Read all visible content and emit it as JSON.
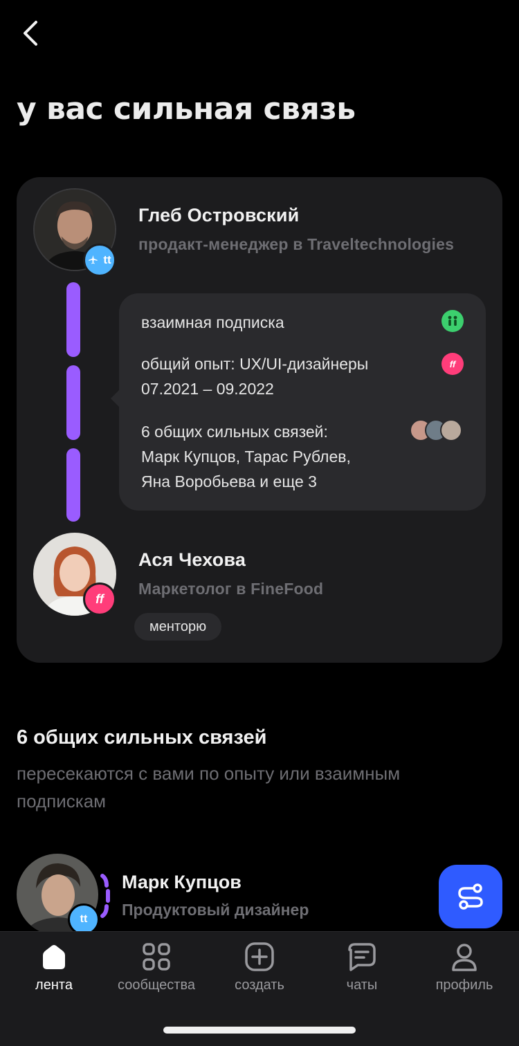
{
  "header": {
    "title": "у вас сильная связь"
  },
  "connection": {
    "person_a": {
      "name": "Глеб Островский",
      "role": "продакт-менеджер в Traveltechnologies",
      "badge_text": "tt"
    },
    "details": {
      "mutual": "взаимная подписка",
      "experience_line1": "общий опыт: UX/UI-дизайнеры",
      "experience_line2": "07.2021 – 09.2022",
      "common_line1": "6 общих сильных связей:",
      "common_line2": "Марк Купцов, Тарас Рублев,",
      "common_line3": "Яна Воробьева и еще 3",
      "exp_badge_text": "ff"
    },
    "person_b": {
      "name": "Ася Чехова",
      "role": "Маркетолог в FineFood",
      "badge_text": "ff",
      "tag": "менторю"
    }
  },
  "common_section": {
    "heading": "6 общих сильных связей",
    "subtitle": "пересекаются с вами по опыту или взаимным подпискам",
    "list": [
      {
        "name": "Марк Купцов",
        "role": "Продуктовый дизайнер",
        "badge_text": "tt"
      }
    ]
  },
  "tabs": [
    {
      "label": "лента",
      "icon": "home-icon",
      "active": true
    },
    {
      "label": "сообщества",
      "icon": "grid-icon",
      "active": false
    },
    {
      "label": "создать",
      "icon": "plus-square-icon",
      "active": false
    },
    {
      "label": "чаты",
      "icon": "chat-icon",
      "active": false
    },
    {
      "label": "профиль",
      "icon": "user-icon",
      "active": false
    }
  ],
  "colors": {
    "accent_purple": "#9a5cff",
    "fab_blue": "#2f5bff",
    "tt_badge": "#4fb4ff",
    "ff_badge": "#ff3d7a",
    "mutual_green": "#3ccf6e"
  }
}
